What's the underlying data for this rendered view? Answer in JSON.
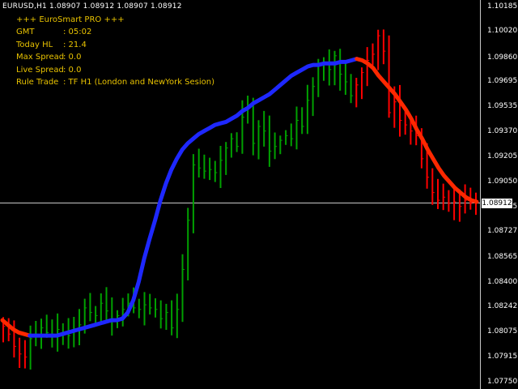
{
  "symbol_line": "EURUSD,H1  1.08907 1.08912 1.08907 1.08912",
  "panel": {
    "title": "+++ EuroSmart PRO +++",
    "rows": [
      {
        "label": "GMT",
        "value": ": 05:02"
      },
      {
        "label": "Today HL",
        "value": ": 21.4"
      },
      {
        "label": "Max Spread",
        "value": ": 0.0"
      },
      {
        "label": "Live Spread",
        "value": ": 0.0"
      },
      {
        "label": "Rule Trade",
        "value": ": TF H1 (London and NewYork Sesion)"
      }
    ]
  },
  "price_axis": {
    "ticks": [
      "1.10185",
      "1.10020",
      "1.09860",
      "1.09695",
      "1.09535",
      "1.09370",
      "1.09205",
      "1.09050",
      "1.08885",
      "1.08727",
      "1.08565",
      "1.08400",
      "1.08242",
      "1.08075",
      "1.07915",
      "1.07750"
    ],
    "current_price": "1.08912"
  },
  "colors": {
    "background": "#000000",
    "bull_candle": "#00a000",
    "bear_candle": "#ff0000",
    "ma_up": "#1e28ff",
    "ma_down": "#ff2800",
    "bid_line": "#c8c8c8",
    "info_text": "#e8c200"
  },
  "chart_data": {
    "type": "line",
    "title": "",
    "xlabel": "",
    "ylabel": "",
    "ylim": [
      1.0775,
      1.10185
    ],
    "current_price": 1.08912,
    "candles_close_hint": [
      1.0811,
      1.0806,
      1.0798,
      1.0793,
      1.0791,
      1.0803,
      1.0805,
      1.081,
      1.0807,
      1.0804,
      1.0809,
      1.0806,
      1.0805,
      1.0809,
      1.0812,
      1.0823,
      1.082,
      1.0818,
      1.0826,
      1.0821,
      1.0815,
      1.0818,
      1.0822,
      1.0826,
      1.0823,
      1.0822,
      1.0825,
      1.0823,
      1.0822,
      1.0816,
      1.082,
      1.081,
      1.0822,
      1.0848,
      1.088,
      1.0916,
      1.0914,
      1.0912,
      1.0913,
      1.0911,
      1.0919,
      1.0927,
      1.0933,
      1.0928,
      1.0947,
      1.0953,
      1.093,
      1.0941,
      1.0938,
      1.0925,
      1.0928,
      1.0932,
      1.0935,
      1.0933,
      1.0945,
      1.0941,
      1.0958,
      1.0967,
      1.0981,
      1.0983,
      1.0978,
      1.0987,
      1.0975,
      1.097,
      1.0961,
      1.0968,
      1.0976,
      1.0984,
      1.0988,
      1.1,
      1.099,
      1.095,
      1.0957,
      1.0945,
      1.0942,
      1.0938,
      1.0935,
      1.092,
      1.0908,
      1.0898,
      1.0893,
      1.0895,
      1.0891,
      1.0892,
      1.0889,
      1.0893,
      1.0891,
      1.0891
    ],
    "series": [
      {
        "x": [
          0,
          1,
          2,
          3,
          4,
          5,
          6,
          7,
          8,
          9,
          10,
          11,
          12,
          13,
          14,
          15,
          16,
          17,
          18,
          19,
          20,
          21,
          22,
          23,
          24,
          25,
          26,
          27,
          28,
          29,
          30,
          31,
          32,
          33,
          34,
          35,
          36,
          37,
          38,
          39,
          40,
          41,
          42,
          43,
          44,
          45,
          46,
          47,
          48,
          49,
          50,
          51,
          52,
          53,
          54,
          55,
          56,
          57,
          58,
          59,
          60,
          61,
          62,
          63,
          64,
          65,
          66,
          67,
          68,
          69,
          70,
          71,
          72,
          73,
          74,
          75,
          76,
          77,
          78,
          79,
          80,
          81,
          82,
          83,
          84,
          85,
          86,
          87
        ],
        "y": [
          1.0815,
          1.0812,
          1.0809,
          1.0807,
          1.0806,
          1.0805,
          1.0805,
          1.0805,
          1.0805,
          1.0805,
          1.0805,
          1.0806,
          1.0807,
          1.0808,
          1.0809,
          1.081,
          1.0811,
          1.0812,
          1.0813,
          1.0814,
          1.0815,
          1.0815,
          1.0816,
          1.082,
          1.0828,
          1.084,
          1.0855,
          1.0868,
          1.088,
          1.0893,
          1.0904,
          1.0913,
          1.092,
          1.0926,
          1.093,
          1.0933,
          1.0936,
          1.0938,
          1.094,
          1.0942,
          1.0943,
          1.0944,
          1.0946,
          1.0948,
          1.0951,
          1.0953,
          1.0956,
          1.0958,
          1.096,
          1.0962,
          1.0965,
          1.0968,
          1.0971,
          1.0974,
          1.0976,
          1.0978,
          1.098,
          1.0981,
          1.0981,
          1.0982,
          1.0982,
          1.0982,
          1.0983,
          1.0983,
          1.0984,
          1.0985,
          1.0984,
          1.0982,
          1.0979,
          1.0974,
          1.097,
          1.0966,
          1.0962,
          1.0957,
          1.0952,
          1.0946,
          1.0939,
          1.0933,
          1.0926,
          1.092,
          1.0914,
          1.0909,
          1.0905,
          1.0901,
          1.0898,
          1.0895,
          1.0893,
          1.0892
        ]
      }
    ]
  }
}
